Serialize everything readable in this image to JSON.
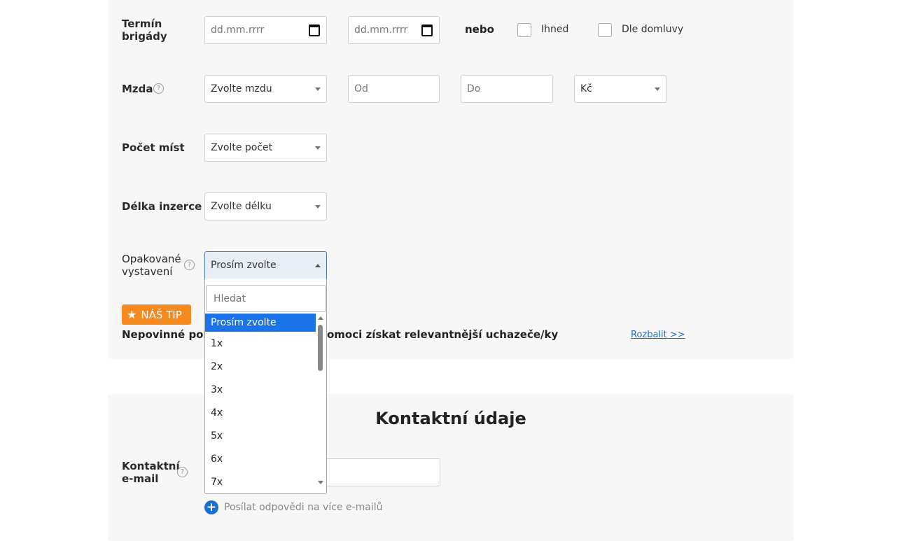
{
  "form": {
    "term_label": "Termín\nbrigády",
    "date_from_placeholder": "dd.mm.rrrr",
    "date_to_placeholder": "dd.mm.rrrr",
    "or_label": "nebo",
    "immediately_label": "Ihned",
    "by_agreement_label": "Dle domluvy",
    "wage_label": "Mzda",
    "wage_select": "Zvolte mzdu",
    "wage_from_placeholder": "Od",
    "wage_to_placeholder": "Do",
    "currency_select": "Kč",
    "positions_label": "Počet míst",
    "positions_select": "Zvolte počet",
    "ad_length_label": "Délka inzerce",
    "ad_length_select": "Zvolte délku",
    "repeat_label": "Opakované\nvystavení",
    "repeat_select": "Prosím zvolte"
  },
  "dropdown": {
    "search_placeholder": "Hledat",
    "options": [
      "Prosím zvolte",
      "1x",
      "2x",
      "3x",
      "4x",
      "5x",
      "6x",
      "7x"
    ],
    "selected_index": 0
  },
  "tip": {
    "badge": "NÁŠ TIP",
    "text_left": "Nepovinné pol",
    "text_right": "omoci získat relevantnější uchazeče/ky",
    "expand_link": "Rozbalit >>"
  },
  "contact": {
    "heading": "Kontaktní údaje",
    "email_label": "Kontaktní\ne-mail",
    "add_more_emails": "Posílat odpovědi na více e-mailů"
  },
  "icons": {
    "help": "question-circle-icon",
    "calendar": "calendar-icon",
    "star": "star-icon",
    "plus": "plus-circle-icon"
  },
  "colors": {
    "accent_blue": "#1a73e8",
    "tip_orange": "#f68a1e",
    "panel_bg": "#f7f7f7"
  }
}
